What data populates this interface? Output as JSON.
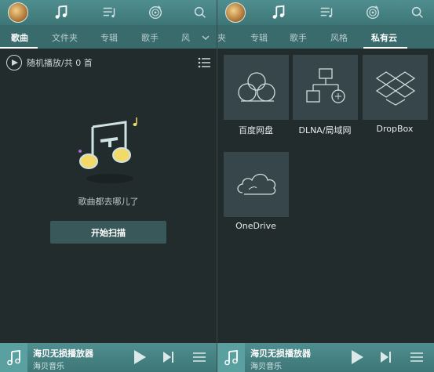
{
  "left": {
    "tabs": [
      "歌曲",
      "文件夹",
      "专辑",
      "歌手",
      "风"
    ],
    "shuffle_label": "随机播放/共 0 首",
    "empty_message": "歌曲都去哪儿了",
    "scan_button": "开始扫描"
  },
  "right": {
    "tabs": [
      "夹",
      "专辑",
      "歌手",
      "风格",
      "私有云"
    ],
    "clouds": [
      {
        "label": "百度网盘",
        "icon": "baidu-cloud-icon"
      },
      {
        "label": "DLNA/局域网",
        "icon": "dlna-network-icon"
      },
      {
        "label": "DropBox",
        "icon": "dropbox-icon"
      },
      {
        "label": "OneDrive",
        "icon": "onedrive-icon"
      }
    ]
  },
  "player": {
    "title": "海贝无损播放器",
    "artist": "海贝音乐"
  },
  "colors": {
    "header": "#4f8e8f",
    "tabs_bg": "#3a6b6c",
    "content_bg": "#232c2d",
    "tile_bg": "#36464a",
    "accent_yellow": "#f3d86a"
  }
}
